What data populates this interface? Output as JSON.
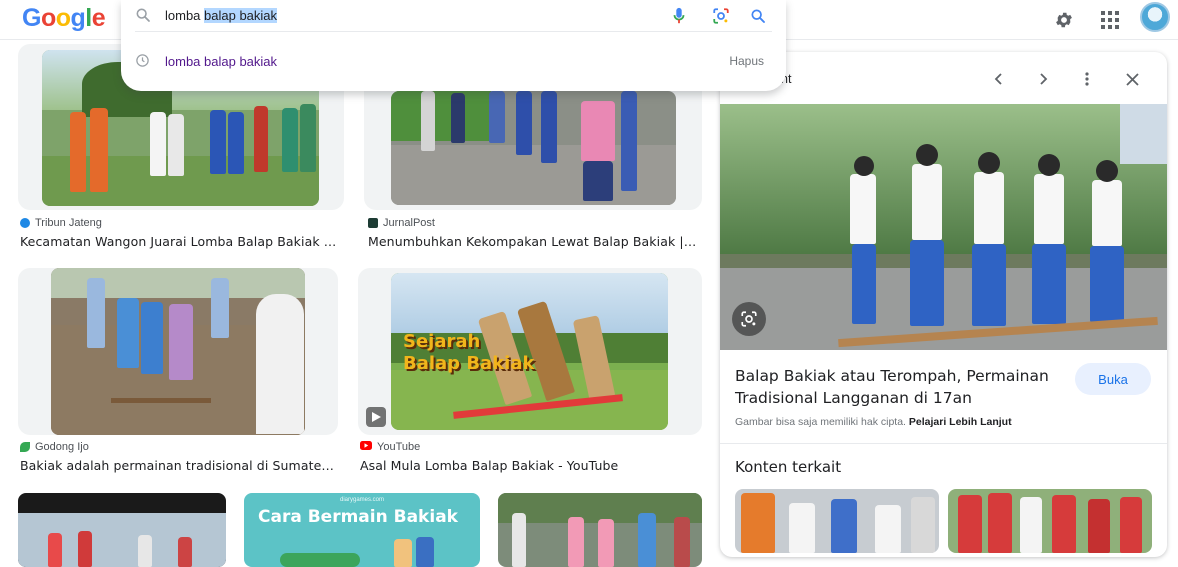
{
  "header": {
    "logo_letters": [
      "G",
      "o",
      "o",
      "g",
      "l",
      "e"
    ],
    "icons": [
      "settings-icon",
      "apps-icon"
    ]
  },
  "search": {
    "query_prefix": "lomba ",
    "query_selected": "balap bakiak",
    "suggestion": "lomba balap bakiak",
    "remove_label": "Hapus",
    "icons": [
      "search-icon",
      "mic-icon",
      "lens-icon",
      "search-submit-icon",
      "history-icon"
    ]
  },
  "results": [
    {
      "source": "Tribun Jateng",
      "title": "Kecamatan Wangon Juarai Lomba Balap Bakiak Ban…"
    },
    {
      "source": "JurnalPost",
      "title": "Menumbuhkan Kekompakan Lewat Balap Bakiak | Jur…"
    },
    {
      "source": "Godong Ijo",
      "title": "Bakiak adalah permainan tradisional di Sumatera B…"
    },
    {
      "source": "YouTube",
      "title": "Asal Mula Lomba Balap Bakiak - YouTube",
      "thumb_text": [
        "Sejarah",
        "Balap Bakiak"
      ]
    },
    {
      "thumb_text": [
        "Cara Bermain Bakiak"
      ],
      "thumb_small": "diarygames.com"
    }
  ],
  "panel": {
    "source": "vingPoint",
    "title": "Balap Bakiak atau Terompah, Permainan Tradisional Langganan di 17an",
    "open_label": "Buka",
    "copyright_prefix": "Gambar bisa saja memiliki hak cipta.",
    "copyright_link": "Pelajari Lebih Lanjut",
    "related_heading": "Konten terkait"
  },
  "colors": {
    "accent": "#1a73e8",
    "visited_link": "#52188c",
    "selection": "#b3d7ff",
    "youtube_red": "#ff0000"
  }
}
